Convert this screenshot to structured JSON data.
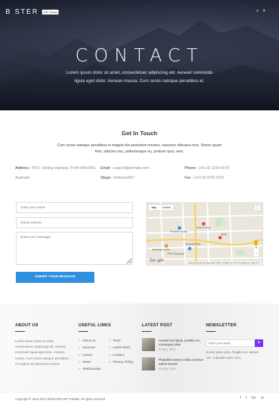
{
  "header": {
    "logo_text": "B  STER",
    "logo_badge": "WP-Theme",
    "icons": [
      "search-icon",
      "menu-icon"
    ],
    "search_glyph": "⌕",
    "menu_glyph": "≡"
  },
  "hero": {
    "title": "CONTACT",
    "subtitle": "Lorem ipsum dolor sit amet, consectetuer adipiscing elit. Aenean commodo ligula eget dolor. Aenean massa. Cum sociis natoque penatibus et."
  },
  "get_in_touch": {
    "title": "Get In Touch",
    "description": "Cum sociis natoque penatibus et magnis dis parturient montes, nascetur ridiculus mus. Donec quam felis, ultricies nec, pellentesque eu, pretium quis, sem."
  },
  "contact_info": {
    "address_label": "Address :",
    "address_value": "58 D, Stirling Highway, Perth WA 6009, Australia",
    "email_label": "Email :",
    "email_value": "support@domain.com",
    "skype_label": "Skype :",
    "skype_value": "theboost007",
    "phone_label": "Phone :",
    "phone_value": "(+61 8) 1234 5678",
    "fax_label": "Fax :",
    "fax_value": "(+61 8) 8765 4321"
  },
  "form": {
    "name_placeholder": "Enter your name",
    "email_placeholder": "Email Address",
    "message_placeholder": "Enter your message...",
    "submit_label": "SUBMIT YOUR MESSAGE"
  },
  "map": {
    "tab_map": "Map",
    "tab_satellite": "Satellite",
    "labels": [
      "Porsche Centre",
      "King Leoling",
      "BWS",
      "Maharaja Indian",
      "Australia Post",
      "PRS Pharmacy"
    ],
    "attribution": "Keyboard shortcuts   Map data ©2017 Google   Terms of Use   Report a map error",
    "google": [
      "G",
      "o",
      "o",
      "g",
      "l",
      "e"
    ],
    "zoom_in": "+",
    "zoom_out": "−",
    "fullscreen": "⛶",
    "accent": "#2f8fe0"
  },
  "footer": {
    "about_title": "ABOUT US",
    "about_text": "Lorem ipsum dolor sit amet, consectetuer adipiscing elit. Aenean commodo ligula eget dolor. Aenean massa. Cum sociis natoque penatibus et magnis dis parturient montes.",
    "links_title": "USEFUL LINKS",
    "links_col1": [
      "About us",
      "Services",
      "Career",
      "News",
      "Testimonials"
    ],
    "links_col2": [
      "Team",
      "Latest Work",
      "Contact",
      "Privacy Policy"
    ],
    "latest_title": "LATEST POST",
    "posts": [
      {
        "title": "Aenean leo ligula, porttitor eu, consequat vitae",
        "date": "30 May, 2016"
      },
      {
        "title": "Phasellus viverra nulla ut metus varius laoreet",
        "date": "28 May, 2016"
      }
    ],
    "newsletter_title": "NEWSLETTER",
    "newsletter_placeholder": "Enter your email...",
    "newsletter_button": "➤",
    "newsletter_text": "Donec pede justo, fringilla vel, aliquet nec, vulputate eget, arcu.",
    "copyright": "Copyright © 2016 2017 BOOSTER WP-THEME. All rights reserved",
    "social": [
      "f",
      "t",
      "G+",
      "in"
    ],
    "newsletter_color": "#7b2ff7"
  }
}
